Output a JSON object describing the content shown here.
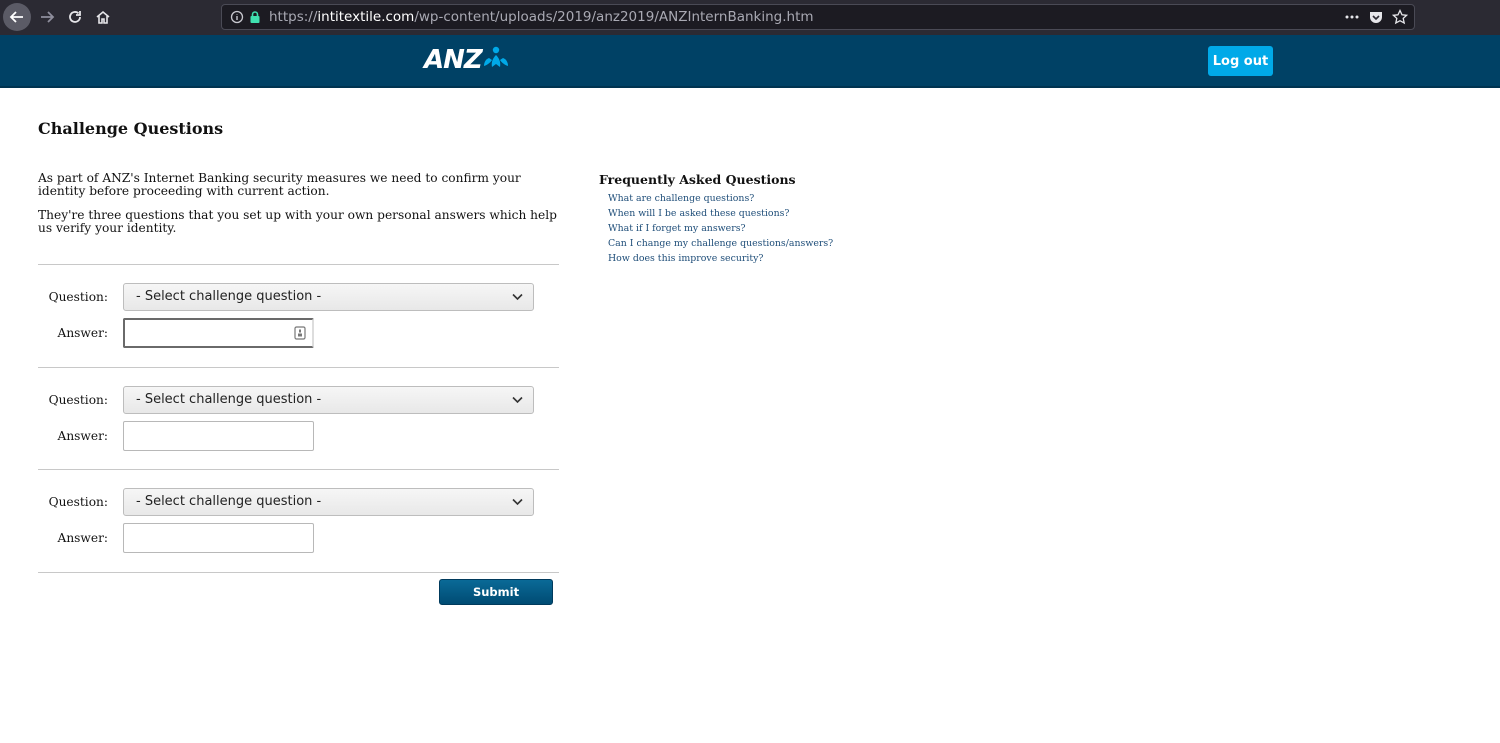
{
  "browser": {
    "url_scheme": "https://",
    "url_host": "intitextile.com",
    "url_path": "/wp-content/uploads/2019/anz2019/ANZInternBanking.htm"
  },
  "header": {
    "logo_text": "ANZ",
    "logout_label": "Log out",
    "bg_color": "#004165",
    "accent_color": "#00a9e8"
  },
  "main": {
    "title": "Challenge Questions",
    "intro": [
      "As part of ANZ's Internet Banking security measures we need to confirm your identity before proceeding with current action.",
      "They're three questions that you set up with your own personal answers which help us verify your identity."
    ],
    "question_label": "Question:",
    "answer_label": "Answer:",
    "questions": [
      {
        "selected": "- Select challenge question -",
        "answer": ""
      },
      {
        "selected": "- Select challenge question -",
        "answer": ""
      },
      {
        "selected": "- Select challenge question -",
        "answer": ""
      }
    ],
    "submit_label": "Submit"
  },
  "faq": {
    "title": "Frequently Asked Questions",
    "items": [
      "What are challenge questions?",
      "When will I be asked these questions?",
      "What if I forget my answers?",
      "Can I change my challenge questions/answers?",
      "How does this improve security?"
    ]
  }
}
